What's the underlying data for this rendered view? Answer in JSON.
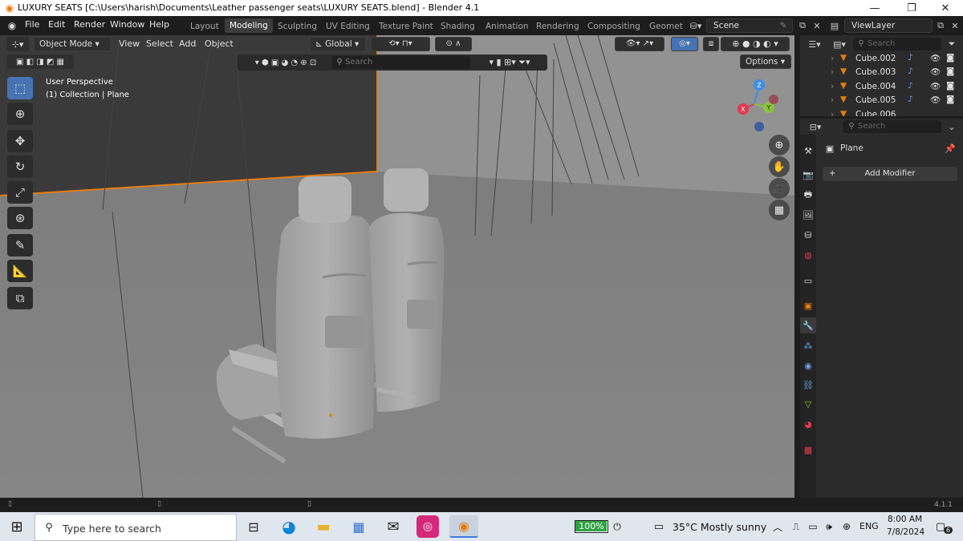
{
  "window": {
    "title": "LUXURY SEATS [C:\\Users\\harish\\Documents\\Leather passenger seats\\LUXURY SEATS.blend] - Blender 4.1",
    "minimize": "—",
    "maximize": "❐",
    "close": "✕"
  },
  "menu": [
    "File",
    "Edit",
    "Render",
    "Window",
    "Help"
  ],
  "workspaces": [
    "Layout",
    "Modeling",
    "Sculpting",
    "UV Editing",
    "Texture Paint",
    "Shading",
    "Animation",
    "Rendering",
    "Compositing",
    "Geomet"
  ],
  "active_workspace": "Modeling",
  "scene": {
    "name": "Scene",
    "view_layer": "ViewLayer"
  },
  "viewport": {
    "mode": "Object Mode",
    "menus": [
      "View",
      "Select",
      "Add",
      "Object"
    ],
    "orientation": "Global",
    "search_placeholder": "Search",
    "options_label": "Options",
    "overlay_line1": "User Perspective",
    "overlay_line2": "(1) Collection | Plane",
    "gizmo": {
      "x": "X",
      "y": "Y",
      "z": "Z"
    }
  },
  "outliner": {
    "search_placeholder": "Search",
    "items": [
      {
        "name": "Cube.002"
      },
      {
        "name": "Cube.003"
      },
      {
        "name": "Cube.004"
      },
      {
        "name": "Cube.005"
      },
      {
        "name": "Cube.006"
      }
    ]
  },
  "properties": {
    "search_placeholder": "Search",
    "object_name": "Plane",
    "add_modifier": "Add Modifier"
  },
  "statusbar": {
    "version": "4.1.1"
  },
  "taskbar": {
    "search_placeholder": "Type here to search",
    "battery": "100%",
    "weather": "35°C  Mostly sunny",
    "lang": "ENG",
    "time": "8:00 AM",
    "date": "7/8/2024",
    "notifications": "6"
  },
  "colors": {
    "accent_orange": "#e87d0d",
    "active_blue": "#4772b3",
    "gizmo_x": "#e0394f",
    "gizmo_y": "#8ac43c",
    "gizmo_z": "#3d8ee8"
  }
}
